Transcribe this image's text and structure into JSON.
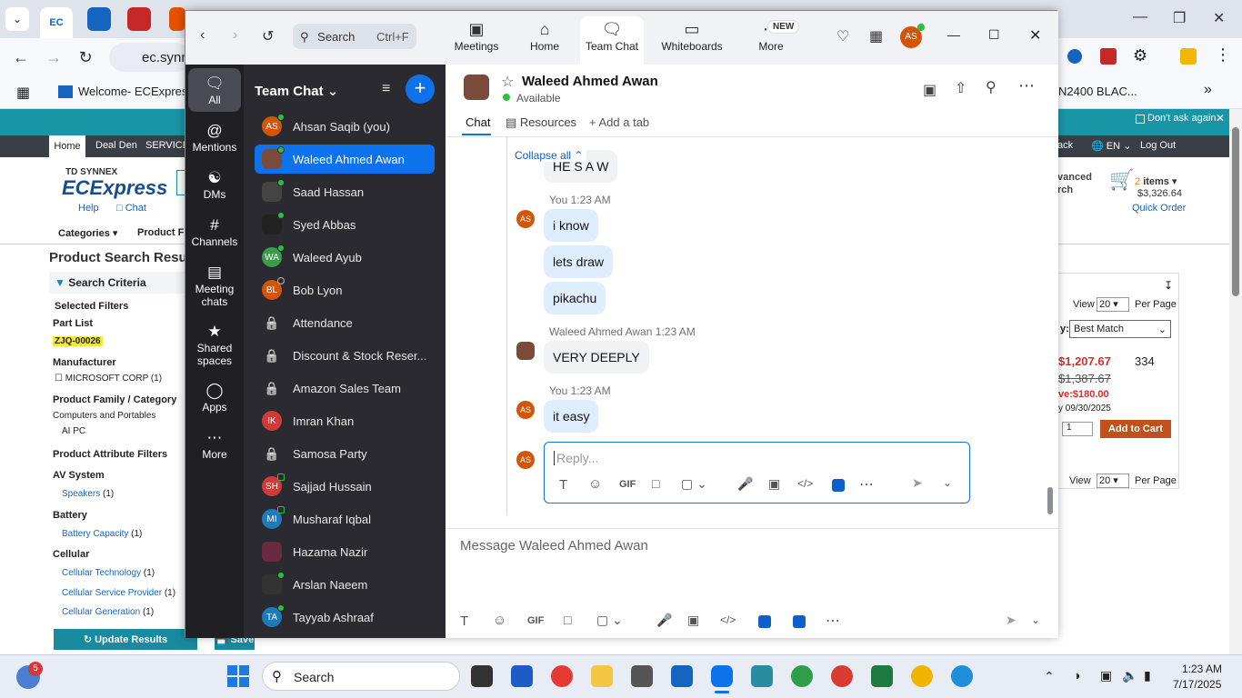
{
  "browser": {
    "tab_logo": "EC",
    "url_fragment": "ec.synn",
    "bookmark": "Welcome- ECExpres...",
    "bookmark_right": "N2400 BLAC..."
  },
  "page": {
    "dont_ask": "Don't ask again.",
    "nav": {
      "home": "Home",
      "deal_den": "Deal Den",
      "services": "SERVICE",
      "back": "ack",
      "lang": "EN",
      "logout": "Log Out"
    },
    "logo_top": "TD SYNNEX",
    "logo_main": "ECExpress",
    "help": "Help",
    "chat": "Chat",
    "advanced_search": "vanced",
    "search_word": "rch",
    "cart_count": "2",
    "cart_items": "items",
    "cart_total": "$3,326.64",
    "quick_order": "Quick Order",
    "categories": "Categories",
    "product_fi": "Product Fi",
    "results_title": "Product Search Resul",
    "search_criteria": "Search Criteria",
    "selected_filters": "Selected Filters",
    "part_list": "Part List",
    "part_tag": "ZJQ-00026",
    "manufacturer": "Manufacturer",
    "mfr_item": "MICROSOFT CORP (1)",
    "family": "Product Family / Category",
    "family_1": "Computers and Portables",
    "family_2": "AI PC",
    "attr_filters": "Product Attribute Filters",
    "av_system": "AV System",
    "speakers": "Speakers",
    "speakers_n": "(1)",
    "battery": "Battery",
    "battery_cap": "Battery Capacity",
    "battery_n": "(1)",
    "cellular": "Cellular",
    "cell_tech": "Cellular Technology",
    "cell_tech_n": "(1)",
    "cell_prov": "Cellular Service Provider",
    "cell_prov_n": "(1)",
    "cell_gen": "Cellular Generation",
    "cell_gen_n": "(1)",
    "update_results": "Update Results",
    "save": "Save",
    "view": "View",
    "per_page_value": "20",
    "per_page": "Per Page",
    "sort_label": "y:",
    "sort_value": "Best Match",
    "price": "$1,207.67",
    "qty_avail": "334",
    "old_price": "$1,387.67",
    "savings": "ve:$180.00",
    "date": "y 09/30/2025",
    "qty": "1",
    "add_to_cart": "Add to Cart"
  },
  "zoom": {
    "search_placeholder": "Search",
    "search_shortcut": "Ctrl+F",
    "tabs": {
      "meetings": "Meetings",
      "home": "Home",
      "team_chat": "Team Chat",
      "whiteboards": "Whiteboards",
      "more": "More",
      "new_badge": "NEW"
    },
    "avatar": "AS",
    "rail": {
      "all": "All",
      "mentions": "Mentions",
      "dms": "DMs",
      "channels": "Channels",
      "meeting_chats_1": "Meeting",
      "meeting_chats_2": "chats",
      "shared_1": "Shared",
      "shared_2": "spaces",
      "apps": "Apps",
      "more": "More"
    },
    "list_title": "Team Chat",
    "chats": [
      {
        "name": "Ahsan Saqib (you)",
        "init": "AS",
        "color": "#d2560a",
        "type": "avatar",
        "presence": "online"
      },
      {
        "name": "Waleed Ahmed Awan",
        "init": "",
        "color": "#7a4a3a",
        "type": "photo",
        "presence": "online",
        "selected": true
      },
      {
        "name": "Saad Hassan",
        "init": "",
        "color": "#444",
        "type": "photo",
        "presence": "online"
      },
      {
        "name": "Syed Abbas",
        "init": "",
        "color": "#222",
        "type": "photo",
        "presence": "online"
      },
      {
        "name": "Waleed Ayub",
        "init": "WA",
        "color": "#3a9d4a",
        "type": "avatar",
        "presence": "online"
      },
      {
        "name": "Bob Lyon",
        "init": "BL",
        "color": "#d2560a",
        "type": "avatar",
        "presence": "away"
      },
      {
        "name": "Attendance",
        "type": "lock"
      },
      {
        "name": "Discount & Stock Reser...",
        "type": "lock"
      },
      {
        "name": "Amazon Sales Team",
        "type": "lock"
      },
      {
        "name": "Imran Khan",
        "init": "IK",
        "color": "#d23a3a",
        "type": "avatar",
        "presence": "none"
      },
      {
        "name": "Samosa Party",
        "type": "lock"
      },
      {
        "name": "Sajjad Hussain",
        "init": "SH",
        "color": "#d23a3a",
        "type": "avatar",
        "presence": "mobile"
      },
      {
        "name": "Musharaf Iqbal",
        "init": "MI",
        "color": "#1e7ab8",
        "type": "avatar",
        "presence": "mobile"
      },
      {
        "name": "Hazama Nazir",
        "init": "",
        "color": "#6a2a40",
        "type": "photo",
        "presence": "none"
      },
      {
        "name": "Arslan Naeem",
        "init": "",
        "color": "#333",
        "type": "photo",
        "presence": "online"
      },
      {
        "name": "Tayyab Ashraaf",
        "init": "TA",
        "color": "#1e7ab8",
        "type": "avatar",
        "presence": "online"
      }
    ],
    "header": {
      "name": "Waleed Ahmed Awan",
      "status": "Available"
    },
    "subtabs": {
      "chat": "Chat",
      "resources": "Resources",
      "add_tab": "Add a tab"
    },
    "collapse_all": "Collapse all",
    "messages": {
      "m0": "HE S A W",
      "you_1": "You",
      "time_1": "1:23 AM",
      "m1": "i know",
      "m2": "lets draw",
      "m3": "pikachu",
      "other_name": "Waleed Ahmed Awan",
      "time_2": "1:23 AM",
      "m4": "VERY DEEPLY",
      "you_2": "You",
      "time_3": "1:23 AM",
      "m5": "it easy"
    },
    "reply_placeholder": "Reply...",
    "message_placeholder": "Message Waleed Ahmed Awan",
    "gif": "GIF"
  },
  "taskbar": {
    "search": "Search",
    "time": "1:23 AM",
    "date": "7/17/2025",
    "notif": "5"
  }
}
